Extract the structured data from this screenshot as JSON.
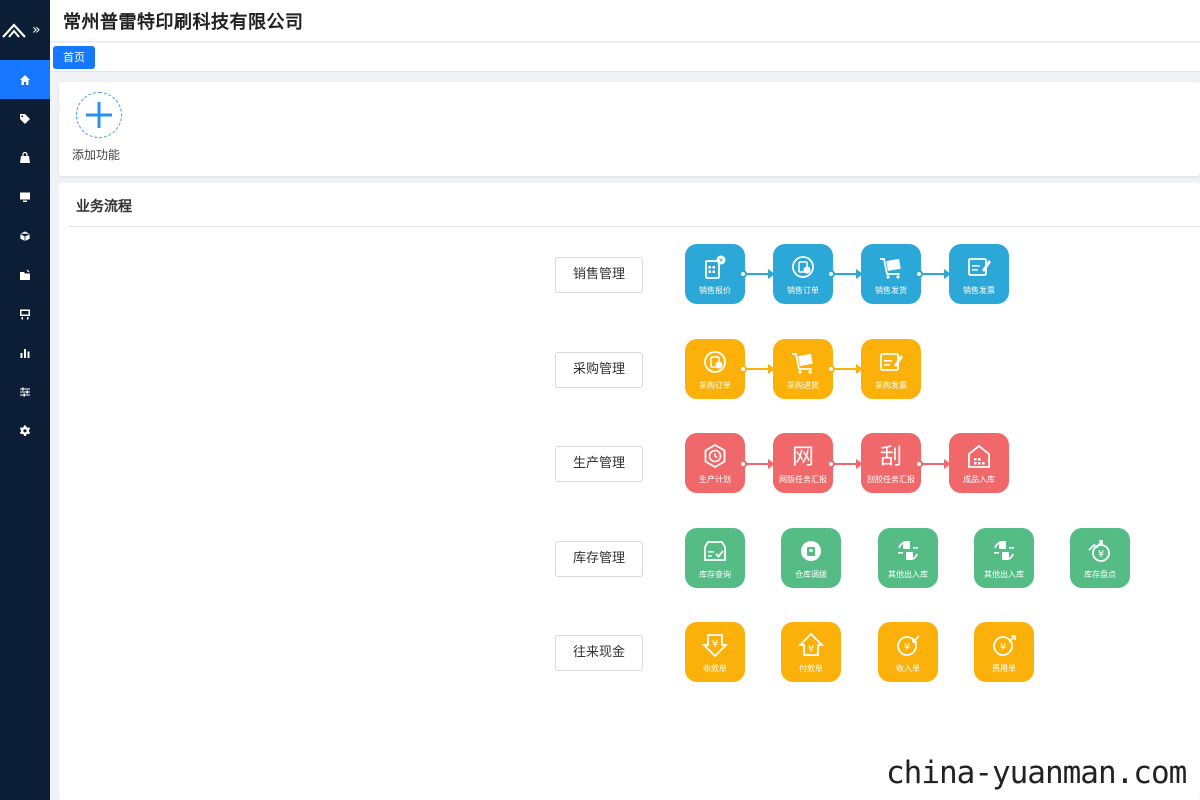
{
  "header": {
    "company": "常州普雷特印刷科技有限公司"
  },
  "tabs": [
    {
      "label": "首页",
      "active": true
    }
  ],
  "sidebar": {
    "items": [
      {
        "icon": "home-icon",
        "active": true
      },
      {
        "icon": "tag-icon"
      },
      {
        "icon": "bag-icon"
      },
      {
        "icon": "monitor-icon"
      },
      {
        "icon": "box-icon"
      },
      {
        "icon": "folder-icon"
      },
      {
        "icon": "cart-icon"
      },
      {
        "icon": "bar-chart-icon"
      },
      {
        "icon": "sliders-icon"
      },
      {
        "icon": "gear-icon"
      }
    ]
  },
  "quick_add": {
    "label": "添加功能"
  },
  "flow": {
    "title": "业务流程",
    "rows": [
      {
        "category": "销售管理",
        "color": "#2ba8d8",
        "items": [
          "销售报价",
          "销售订单",
          "销售发货",
          "销售发票"
        ]
      },
      {
        "category": "采购管理",
        "color": "#fbb10a",
        "items": [
          "采购订单",
          "采购进货",
          "采购发票"
        ]
      },
      {
        "category": "生产管理",
        "color": "#f0686a",
        "items": [
          "生产计划",
          "网版任务汇报",
          "刮胶任务汇报",
          "成品入库"
        ],
        "glyphs": [
          "",
          "网",
          "刮",
          ""
        ]
      },
      {
        "category": "库存管理",
        "color": "#56bc86",
        "items": [
          "库存查询",
          "仓库调拨",
          "其他出入库",
          "其他出入库",
          "库存盘点"
        ]
      },
      {
        "category": "往来现金",
        "color": "#fbb10a",
        "items": [
          "收款单",
          "付款单",
          "收入单",
          "费用单"
        ]
      }
    ]
  },
  "watermark": "china-yuanman.com"
}
